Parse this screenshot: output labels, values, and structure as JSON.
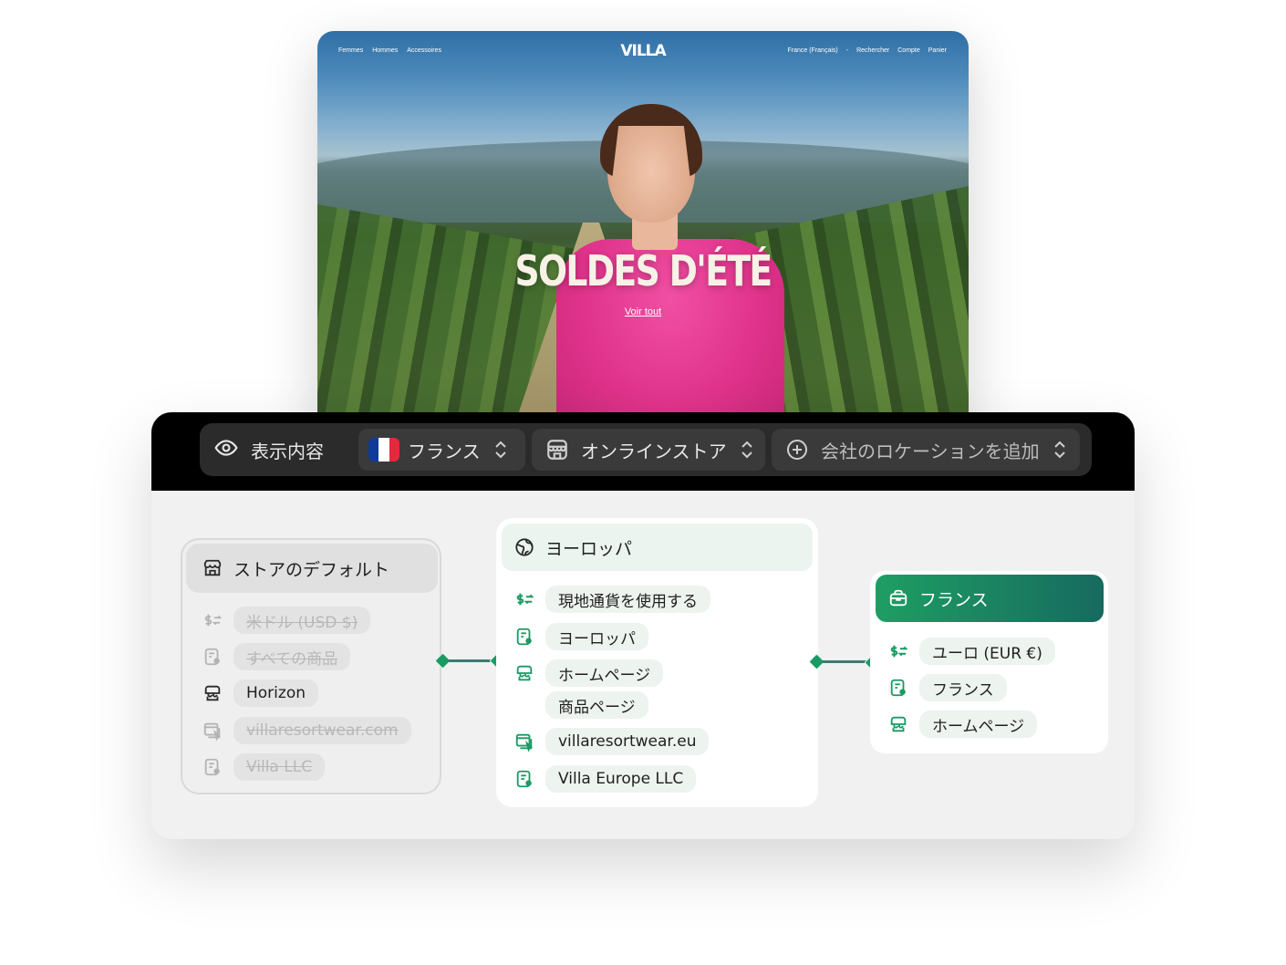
{
  "storefront": {
    "nav_left": [
      "Femmes",
      "Hommes",
      "Accessoires"
    ],
    "logo": "VILLA",
    "nav_right": [
      "France (Français)",
      "-",
      "Rechercher",
      "Compte",
      "Panier"
    ],
    "hero_title": "SOLDES D'ÉTÉ",
    "hero_link": "Voir tout"
  },
  "toolbar": {
    "view_label": "表示内容",
    "country": "フランス",
    "channel": "オンラインストア",
    "location": "会社のロケーションを追加"
  },
  "store_default": {
    "title": "ストアのデフォルト",
    "items": [
      {
        "icon": "currency-exchange-icon",
        "label": "米ドル (USD $)",
        "muted": true
      },
      {
        "icon": "catalog-icon",
        "label": "すべての商品",
        "muted": true
      },
      {
        "icon": "theme-icon",
        "label": "Horizon",
        "muted": false
      },
      {
        "icon": "domain-icon",
        "label": "villaresortwear.com",
        "muted": true
      },
      {
        "icon": "legal-entity-icon",
        "label": "Villa LLC",
        "muted": true
      }
    ]
  },
  "europe": {
    "title": "ヨーロッパ",
    "items": [
      {
        "icon": "currency-exchange-icon",
        "label": "現地通貨を使用する"
      },
      {
        "icon": "catalog-icon",
        "label": "ヨーロッパ"
      },
      {
        "icon": "theme-icon",
        "label": "ホームページ"
      },
      {
        "icon": "",
        "label": "商品ページ"
      },
      {
        "icon": "domain-icon",
        "label": "villaresortwear.eu"
      },
      {
        "icon": "legal-entity-icon",
        "label": "Villa Europe LLC"
      }
    ]
  },
  "france": {
    "title": "フランス",
    "items": [
      {
        "icon": "currency-exchange-icon",
        "label": "ユーロ (EUR €)"
      },
      {
        "icon": "catalog-icon",
        "label": "フランス"
      },
      {
        "icon": "theme-icon",
        "label": "ホームページ"
      }
    ]
  },
  "colors": {
    "accent_green": "#1b9a64",
    "accent_teal": "#176a5f",
    "flag_blue": "#0f3a9c",
    "flag_red": "#e6283c"
  }
}
